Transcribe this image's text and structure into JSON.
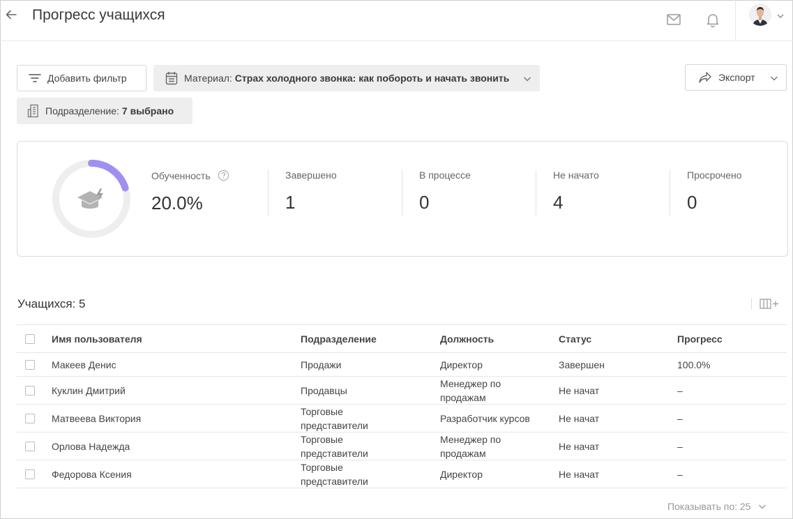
{
  "header": {
    "title": "Прогресс учащихся",
    "icons": {
      "back": "arrow-left-icon",
      "mail": "mail-icon",
      "bell": "bell-icon"
    }
  },
  "filters": {
    "add_filter_label": "Добавить фильтр",
    "material": {
      "label": "Материал:",
      "value": "Страх холодного звонка: как побороть и начать звонить"
    },
    "division": {
      "label": "Подразделение:",
      "value": "7 выбрано"
    },
    "export_label": "Экспорт"
  },
  "stats": {
    "progress_fraction": 0.2,
    "accent_color": "#a18ff0",
    "items": [
      {
        "label": "Обученность",
        "value": "20.0%"
      },
      {
        "label": "Завершено",
        "value": "1"
      },
      {
        "label": "В процессе",
        "value": "0"
      },
      {
        "label": "Не начато",
        "value": "4"
      },
      {
        "label": "Просрочено",
        "value": "0"
      }
    ]
  },
  "table": {
    "count_label": "Учащихся: 5",
    "headers": {
      "name": "Имя пользователя",
      "division": "Подразделение",
      "position": "Должность",
      "status": "Статус",
      "progress": "Прогресс"
    },
    "rows": [
      {
        "name": "Макеев Денис",
        "division": "Продажи",
        "position": "Директор",
        "status": "Завершен",
        "progress": "100.0%"
      },
      {
        "name": "Куклин Дмитрий",
        "division": "Продавцы",
        "position": "Менеджер по продажам",
        "status": "Не начат",
        "progress": "–"
      },
      {
        "name": "Матвеева Виктория",
        "division": "Торговые представители",
        "position": "Разработчик курсов",
        "status": "Не начат",
        "progress": "–"
      },
      {
        "name": "Орлова Надежда",
        "division": "Торговые представители",
        "position": "Менеджер по продажам",
        "status": "Не начат",
        "progress": "–"
      },
      {
        "name": "Федорова Ксения",
        "division": "Торговые представители",
        "position": "Директор",
        "status": "Не начат",
        "progress": "–"
      }
    ]
  },
  "footer": {
    "page_size_label": "Показывать по: 25"
  }
}
